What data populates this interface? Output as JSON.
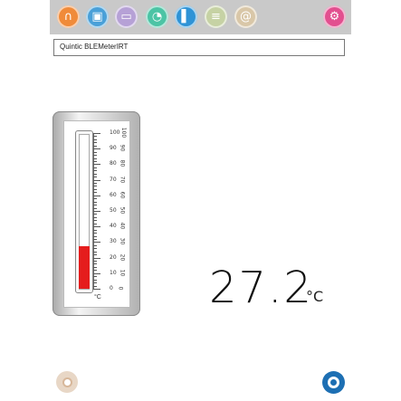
{
  "toolbar": {
    "buttons": [
      {
        "name": "scan-icon",
        "color": "#f08b3a",
        "glyph": "∩"
      },
      {
        "name": "save-icon",
        "color": "#4aa0d8",
        "glyph": "▣"
      },
      {
        "name": "folder-icon",
        "color": "#b6a1d6",
        "glyph": "▭"
      },
      {
        "name": "gauge-icon",
        "color": "#4cc4a5",
        "glyph": "◔"
      },
      {
        "name": "chart-icon",
        "color": "#2f93d6",
        "glyph": "▌"
      },
      {
        "name": "list-icon",
        "color": "#c6d2a4",
        "glyph": "≡"
      },
      {
        "name": "at-icon",
        "color": "#d9c7a8",
        "glyph": "@"
      },
      {
        "name": "settings-icon",
        "color": "#e24f8f",
        "glyph": "⚙"
      }
    ]
  },
  "device": {
    "name": "Quintic BLEMeterIRT"
  },
  "thermometer": {
    "scale_min": 0,
    "scale_max": 100,
    "right_labels": [
      "100",
      "90",
      "80",
      "70",
      "60",
      "50",
      "40",
      "30",
      "20",
      "10",
      "0"
    ],
    "left_labels": [
      "0",
      "10",
      "20",
      "30",
      "40",
      "50",
      "60",
      "70",
      "80",
      "90",
      "100"
    ],
    "unit": "°C",
    "fill_color": "#e51d1d"
  },
  "reading": {
    "value": "27.2",
    "unit": "°C"
  },
  "footer": {
    "camera_icon": "camera-icon",
    "logo_icon": "quintic-logo"
  }
}
